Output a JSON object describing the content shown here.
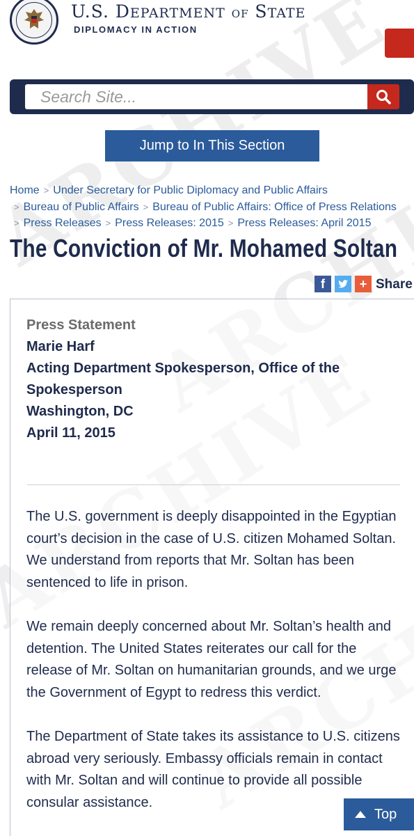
{
  "header": {
    "department_title": "U.S. Department of State",
    "tagline": "DIPLOMACY IN ACTION",
    "watermark": "ARCHIVE"
  },
  "search": {
    "placeholder": "Search Site...",
    "icon": "search-icon"
  },
  "jump_button": "Jump to In This Section",
  "breadcrumb": [
    "Home",
    "Under Secretary for Public Diplomacy and Public Affairs",
    "Bureau of Public Affairs",
    "Bureau of Public Affairs: Office of Press Relations",
    "Press Releases",
    "Press Releases: 2015",
    "Press Releases: April 2015"
  ],
  "page_title": "The Conviction of Mr. Mohamed Soltan",
  "share": {
    "label": "Share",
    "icons": [
      "facebook-icon",
      "twitter-icon",
      "plus-icon"
    ]
  },
  "statement": {
    "type": "Press Statement",
    "speaker": "Marie Harf",
    "role": "Acting Department Spokesperson, Office of the Spokesperson",
    "location": "Washington, DC",
    "date": "April 11, 2015"
  },
  "paragraphs": [
    "The U.S. government is deeply disappointed in the Egyptian court’s decision in the case of U.S. citizen Mohamed Soltan. We understand from reports that Mr. Soltan has been sentenced to life in prison.",
    "We remain deeply concerned about Mr. Soltan’s health and detention. The United States reiterates our call for the release of Mr. Soltan on humanitarian grounds, and we urge the Government of Egypt to redress this verdict.",
    "The Department of State takes its assistance to U.S. citizens abroad very seriously. Embassy officials remain in contact with Mr. Soltan and will continue to provide all possible consular assistance."
  ],
  "top_button": "Top",
  "colors": {
    "navy": "#1f2b4d",
    "link_blue": "#2b5b9a",
    "accent_red": "#c5281c"
  }
}
